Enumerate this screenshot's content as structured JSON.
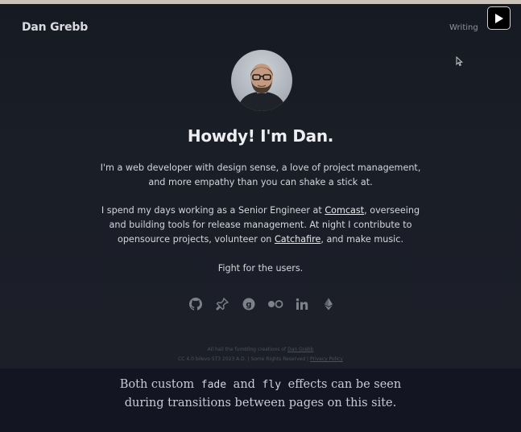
{
  "site": {
    "brand": "Dan Grebb",
    "nav": {
      "writing": "Writing"
    }
  },
  "hero": {
    "headline": "Howdy! I'm Dan.",
    "intro_line1": "I'm a web developer with design sense, a love of project management,",
    "intro_line2": "and more empathy than you can shake a stick at.",
    "work_line1_before": "I spend my days working as a Senior Engineer at ",
    "work_link_comcast": "Comcast",
    "work_line1_after": ", overseeing",
    "work_line2": "and building tools for release management. At night I contribute to",
    "work_line3_before": "opensource projects, volunteer on ",
    "work_link_catchafire": "Catchafire",
    "work_line3_after": ", and make music.",
    "motto": "Fight for the users."
  },
  "social_icons": [
    "github-icon",
    "pin-icon",
    "goodreads-icon",
    "flickr-icon",
    "linkedin-icon",
    "ethereum-icon"
  ],
  "footer": {
    "line1_before": "All hail the fumbling creations of ",
    "line1_link": "Dan Grebb",
    "line2_before": "CC 4.0 bilevo ST3 2023 A.D. | Some Rights Reserved | ",
    "line2_link": "Privacy Policy"
  },
  "caption": {
    "part1": "Both custom",
    "code1": "fade",
    "part2": "and",
    "code2": "fly",
    "part3": "effects can be seen",
    "line2": "during transitions between pages on this site."
  },
  "colors": {
    "page_bg": "#1a1e27",
    "caption_bg": "#131522",
    "text": "#d4d6db"
  }
}
